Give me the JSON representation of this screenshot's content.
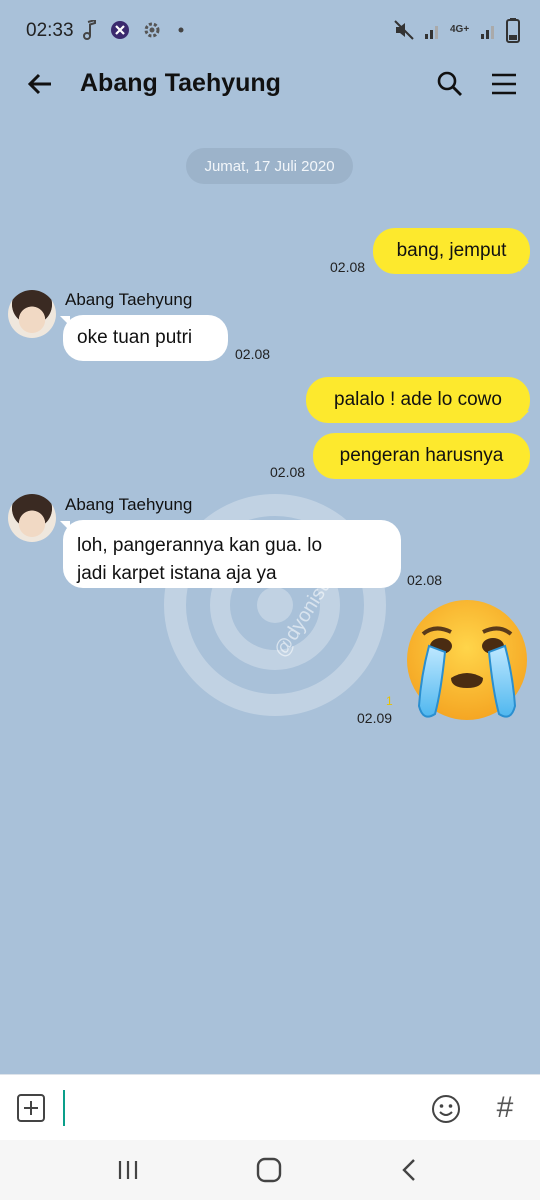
{
  "status_bar": {
    "time": "02:33",
    "network": "4G+",
    "icons": [
      "music-note-icon",
      "app-badge-icon",
      "settings-gear-icon",
      "dot-icon",
      "mute-icon",
      "signal-icon",
      "signal-icon",
      "battery-icon"
    ]
  },
  "header": {
    "title": "Abang Taehyung",
    "back_icon": "back-arrow-icon",
    "search_icon": "search-icon",
    "menu_icon": "menu-icon"
  },
  "chat": {
    "date_divider": "Jumat, 17 Juli 2020",
    "messages": [
      {
        "direction": "out",
        "text": "bang, jemput",
        "time": "02.08"
      },
      {
        "direction": "in",
        "sender": "Abang Taehyung",
        "text": "oke tuan putri",
        "time": "02.08"
      },
      {
        "direction": "out",
        "text": "palalo ! ade lo cowo"
      },
      {
        "direction": "out",
        "text": "pengeran harusnya",
        "time": "02.08"
      },
      {
        "direction": "in",
        "sender": "Abang Taehyung",
        "text_lines": [
          "loh, pangerannya kan gua. lo",
          "jadi karpet istana aja ya"
        ],
        "time": "02.08"
      },
      {
        "direction": "out",
        "type": "sticker",
        "sticker": "crying-face-emoji",
        "read_count": "1",
        "time": "02.09"
      }
    ]
  },
  "watermark": {
    "text": "@dyonisus52"
  },
  "composer": {
    "input_value": "",
    "add_icon": "add-icon",
    "emoji_icon": "emoji-icon",
    "hashtag_label": "#"
  },
  "colors": {
    "chat_background": "#a9c1d9",
    "outgoing_bubble": "#fde92d",
    "incoming_bubble": "#ffffff",
    "accent_caret": "#0a9f8a"
  }
}
